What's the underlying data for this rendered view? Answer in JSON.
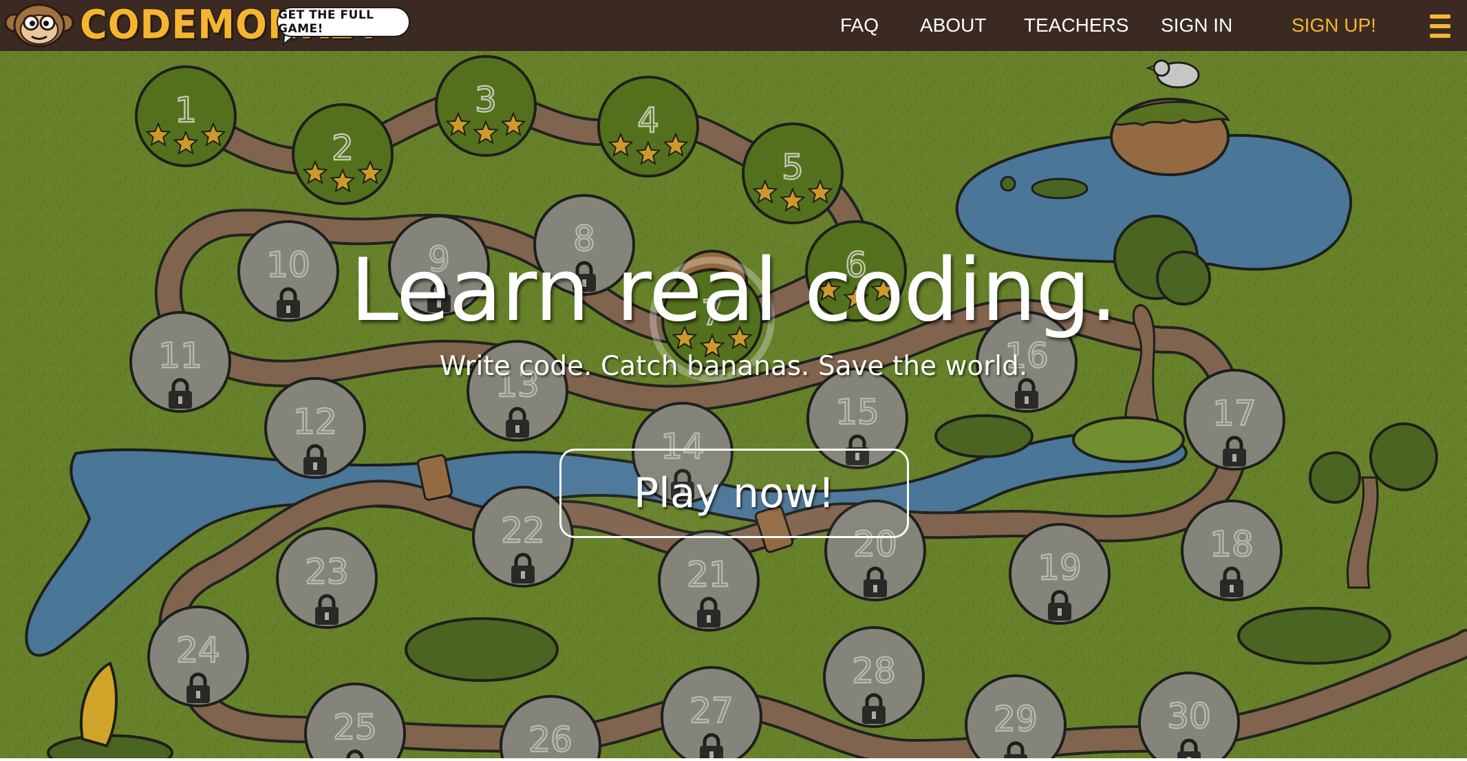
{
  "brand": {
    "name": "CodeMonkey",
    "wordmark": "CODEMONKEY",
    "promo": "GET THE FULL GAME!",
    "colors": {
      "accent": "#f5b531",
      "header_bg": "#3a2a22",
      "grass": "#6e8c2c",
      "water": "#4f7fa8",
      "path": "#8b6b55"
    }
  },
  "nav": {
    "items": [
      "FAQ",
      "ABOUT",
      "TEACHERS",
      "SIGN IN",
      "SIGN UP!"
    ],
    "menu_icon": "hamburger-icon"
  },
  "hero": {
    "title": "Learn real coding.",
    "subtitle": "Write code. Catch bananas. Save the world.",
    "cta": "Play now!"
  },
  "map": {
    "levels": [
      {
        "n": "1",
        "state": "completed",
        "stars": 3
      },
      {
        "n": "2",
        "state": "completed",
        "stars": 3
      },
      {
        "n": "3",
        "state": "completed",
        "stars": 3
      },
      {
        "n": "4",
        "state": "completed",
        "stars": 3
      },
      {
        "n": "5",
        "state": "completed",
        "stars": 3
      },
      {
        "n": "6",
        "state": "completed",
        "stars": 3
      },
      {
        "n": "7",
        "state": "current",
        "stars": 3
      },
      {
        "n": "8",
        "state": "locked"
      },
      {
        "n": "9",
        "state": "locked"
      },
      {
        "n": "10",
        "state": "locked"
      },
      {
        "n": "11",
        "state": "locked"
      },
      {
        "n": "12",
        "state": "locked"
      },
      {
        "n": "13",
        "state": "locked"
      },
      {
        "n": "14",
        "state": "locked"
      },
      {
        "n": "15",
        "state": "locked"
      },
      {
        "n": "16",
        "state": "locked"
      },
      {
        "n": "17",
        "state": "locked"
      },
      {
        "n": "18",
        "state": "locked"
      },
      {
        "n": "19",
        "state": "locked"
      },
      {
        "n": "20",
        "state": "locked"
      },
      {
        "n": "21",
        "state": "locked"
      },
      {
        "n": "22",
        "state": "locked"
      },
      {
        "n": "23",
        "state": "locked"
      },
      {
        "n": "24",
        "state": "locked"
      },
      {
        "n": "25",
        "state": "locked"
      },
      {
        "n": "26",
        "state": "locked"
      },
      {
        "n": "27",
        "state": "locked"
      },
      {
        "n": "28",
        "state": "locked"
      },
      {
        "n": "29",
        "state": "locked"
      },
      {
        "n": "30",
        "state": "locked"
      }
    ]
  }
}
